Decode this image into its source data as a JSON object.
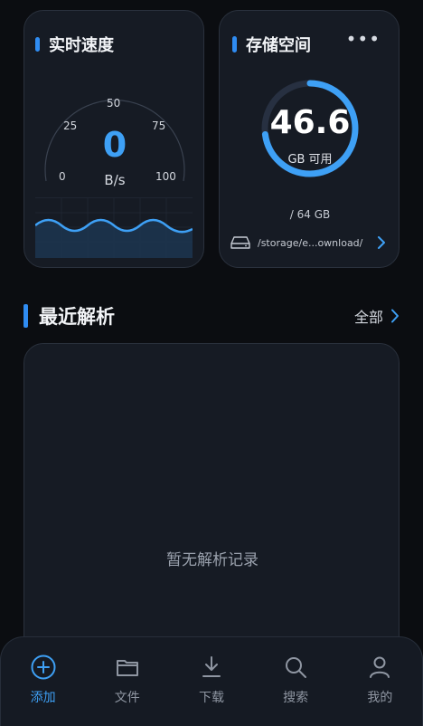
{
  "speed_card": {
    "title": "实时速度",
    "value": "0",
    "unit": "B/s",
    "ticks": [
      "0",
      "25",
      "50",
      "75",
      "100"
    ]
  },
  "storage_card": {
    "title": "存储空间",
    "more_icon": "more-horizontal-icon",
    "available_value": "46.6",
    "available_label": "GB 可用",
    "available_fraction": 0.728,
    "total": "/ 64 GB",
    "path": "/storage/e...ownload/",
    "path_icon": "drive-icon"
  },
  "recent": {
    "title": "最近解析",
    "see_all": "全部",
    "empty_text": "暂无解析记录"
  },
  "bottom_nav": {
    "items": [
      {
        "label": "添加",
        "icon": "add-circle-icon",
        "active": true
      },
      {
        "label": "文件",
        "icon": "folder-icon",
        "active": false
      },
      {
        "label": "下载",
        "icon": "download-icon",
        "active": false
      },
      {
        "label": "搜索",
        "icon": "search-icon",
        "active": false
      },
      {
        "label": "我的",
        "icon": "profile-icon",
        "active": false
      }
    ]
  },
  "colors": {
    "accent": "#3ea0f5",
    "background": "#0b0d11",
    "card": "#161b24"
  }
}
